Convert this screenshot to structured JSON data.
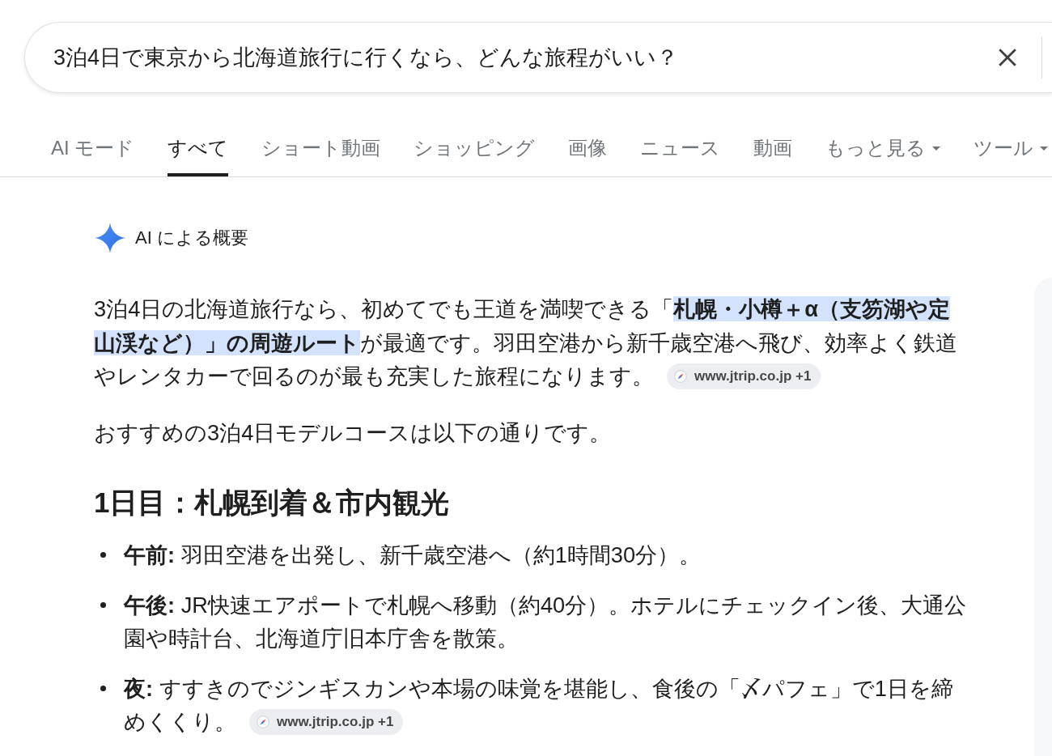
{
  "search": {
    "value": "3泊4日で東京から北海道旅行に行くなら、どんな旅程がいい？"
  },
  "tabs": [
    {
      "label": "AI モード",
      "kind": "tab",
      "selected": false
    },
    {
      "label": "すべて",
      "kind": "tab",
      "selected": true
    },
    {
      "label": "ショート動画",
      "kind": "tab",
      "selected": false
    },
    {
      "label": "ショッピング",
      "kind": "tab",
      "selected": false
    },
    {
      "label": "画像",
      "kind": "tab",
      "selected": false
    },
    {
      "label": "ニュース",
      "kind": "tab",
      "selected": false
    },
    {
      "label": "動画",
      "kind": "tab",
      "selected": false
    },
    {
      "label": "もっと見る",
      "kind": "menu",
      "selected": false
    },
    {
      "label": "ツール",
      "kind": "menu",
      "selected": false
    }
  ],
  "ai_overview": {
    "title": "AI による概要",
    "paragraphs": [
      {
        "text": "3泊4日の北海道旅行なら、初めてでも王道を満喫できる「**札幌・小樽＋α（支笏湖や定山渓など）」の周遊ルート**が最適です。羽田空港から新千歳空港へ飛び、効率よく鉄道やレンタカーで回るのが最も充実した旅程になります。",
        "citation": "www.jtrip.co.jp +1"
      },
      {
        "text": "おすすめの3泊4日モデルコースは以下の通りです。"
      }
    ],
    "sections": [
      {
        "heading": "1日目：札幌到着＆市内観光",
        "items": [
          {
            "text": "**午前:** 羽田空港を出発し、新千歳空港へ（約1時間30分）。"
          },
          {
            "text": "**午後:** JR快速エアポートで札幌へ移動（約40分）。ホテルにチェックイン後、大通公園や時計台、北海道庁旧本庁舎を散策。"
          },
          {
            "text": "**夜:** すすきのでジンギスカンや本場の味覚を堪能し、食後の「〆パフェ」で1日を締めくくり。",
            "citation": "www.jtrip.co.jp +1"
          }
        ]
      }
    ]
  }
}
